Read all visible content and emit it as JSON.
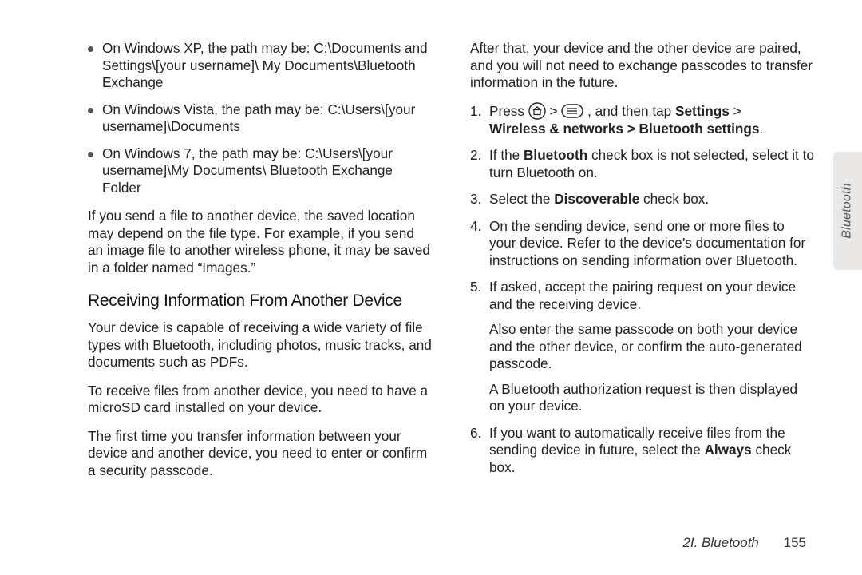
{
  "left": {
    "bullets": [
      "On Windows XP, the path may be: C:\\Documents and Settings\\[your username]\\ My Documents\\Bluetooth Exchange",
      "On Windows Vista, the path may be: C:\\Users\\[your username]\\Documents",
      "On Windows 7, the path may be: C:\\Users\\[your username]\\My Documents\\ Bluetooth Exchange Folder"
    ],
    "para1": "If you send a file to another device, the saved location may depend on the file type. For example, if you send an image file to another wireless phone, it may be saved in a folder named “Images.”",
    "heading": "Receiving Information From Another Device",
    "para2": "Your device is capable of receiving a wide variety of file types with Bluetooth, including photos, music tracks, and documents such as PDFs.",
    "para3": "To receive files from another device, you need to have a microSD card installed on your device.",
    "para4": "The first time you transfer information between your device and another device, you need to enter or confirm a security passcode."
  },
  "right": {
    "intro": "After that, your device and the other device are paired, and you will not need to exchange passcodes to transfer information in the future.",
    "step1_pre": "Press ",
    "step1_mid": ", and then tap ",
    "step1_settings": "Settings",
    "gt": " > ",
    "step1_line2": "Wireless & networks > Bluetooth settings",
    "step2_pre": "If the ",
    "step2_bt": "Bluetooth",
    "step2_post": " check box is not selected, select it to turn Bluetooth on.",
    "step3_pre": "Select the ",
    "step3_disc": "Discoverable",
    "step3_post": " check box.",
    "step4": "On the sending device, send one or more files to your device. Refer to the device’s documentation for instructions on sending information over Bluetooth.",
    "step5": "If asked, accept the pairing request on your device and the receiving device.",
    "step5_sub1": "Also enter the same passcode on both your device and the other device, or confirm the auto-generated passcode.",
    "step5_sub2": "A Bluetooth authorization request is then displayed on your device.",
    "step6_pre": "If you want to automatically receive files from the sending device in future, select the ",
    "step6_always": "Always",
    "step6_post": " check box."
  },
  "footer": {
    "section": "2I. Bluetooth",
    "page": "155"
  },
  "sidetab": "Bluetooth"
}
